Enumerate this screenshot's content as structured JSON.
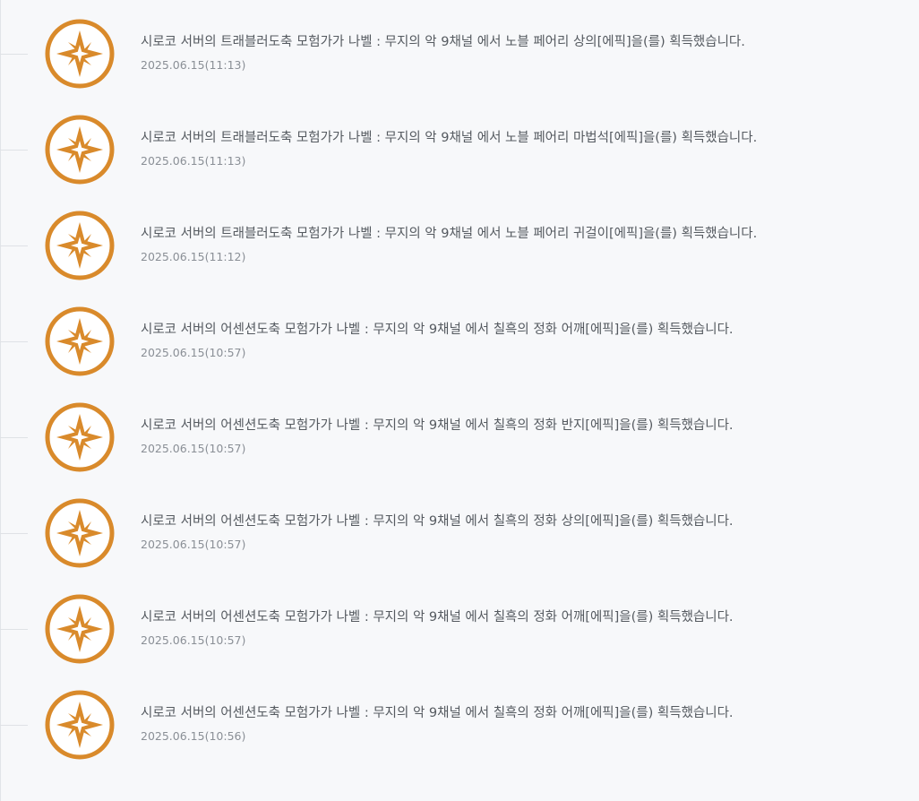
{
  "accent_color": "#d98a2b",
  "icon": "compass-star-icon",
  "entries": [
    {
      "message": "시로코 서버의 트래블러도축 모험가가 나벨 : 무지의 악 9채널 에서 노블 페어리 상의[에픽]을(를) 획득했습니다.",
      "date": "2025.06.15(11:13)"
    },
    {
      "message": "시로코 서버의 트래블러도축 모험가가 나벨 : 무지의 악 9채널 에서 노블 페어리 마법석[에픽]을(를) 획득했습니다.",
      "date": "2025.06.15(11:13)"
    },
    {
      "message": "시로코 서버의 트래블러도축 모험가가 나벨 : 무지의 악 9채널 에서 노블 페어리 귀걸이[에픽]을(를) 획득했습니다.",
      "date": "2025.06.15(11:12)"
    },
    {
      "message": "시로코 서버의 어센션도축 모험가가 나벨 : 무지의 악 9채널 에서 칠흑의 정화 어깨[에픽]을(를) 획득했습니다.",
      "date": "2025.06.15(10:57)"
    },
    {
      "message": "시로코 서버의 어센션도축 모험가가 나벨 : 무지의 악 9채널 에서 칠흑의 정화 반지[에픽]을(를) 획득했습니다.",
      "date": "2025.06.15(10:57)"
    },
    {
      "message": "시로코 서버의 어센션도축 모험가가 나벨 : 무지의 악 9채널 에서 칠흑의 정화 상의[에픽]을(를) 획득했습니다.",
      "date": "2025.06.15(10:57)"
    },
    {
      "message": "시로코 서버의 어센션도축 모험가가 나벨 : 무지의 악 9채널 에서 칠흑의 정화 어깨[에픽]을(를) 획득했습니다.",
      "date": "2025.06.15(10:57)"
    },
    {
      "message": "시로코 서버의 어센션도축 모험가가 나벨 : 무지의 악 9채널 에서 칠흑의 정화 어깨[에픽]을(를) 획득했습니다.",
      "date": "2025.06.15(10:56)"
    }
  ]
}
